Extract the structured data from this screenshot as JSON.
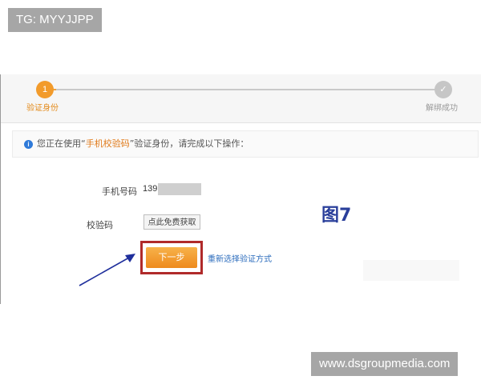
{
  "watermark": {
    "top_left": "TG: MYYJJPP",
    "bottom_right": "www.dsgroupmedia.com"
  },
  "progress": {
    "step1_number": "1",
    "step1_label": "验证身份",
    "step2_label": "解绑成功"
  },
  "notice": {
    "prefix": "您正在使用“",
    "method": "手机校验码",
    "suffix": "”验证身份，请完成以下操作："
  },
  "form": {
    "phone_label": "手机号码",
    "phone_value": "139",
    "code_label": "校验码",
    "code_button": "点此免费获取",
    "next_button": "下一步",
    "switch_link": "重新选择验证方式"
  },
  "annotation": {
    "figure_label": "图7"
  },
  "colors": {
    "accent_orange": "#f29b2b",
    "highlight_box": "#b02a2a",
    "link_blue": "#2d6dbd",
    "figure_label": "#2a3f9b"
  }
}
